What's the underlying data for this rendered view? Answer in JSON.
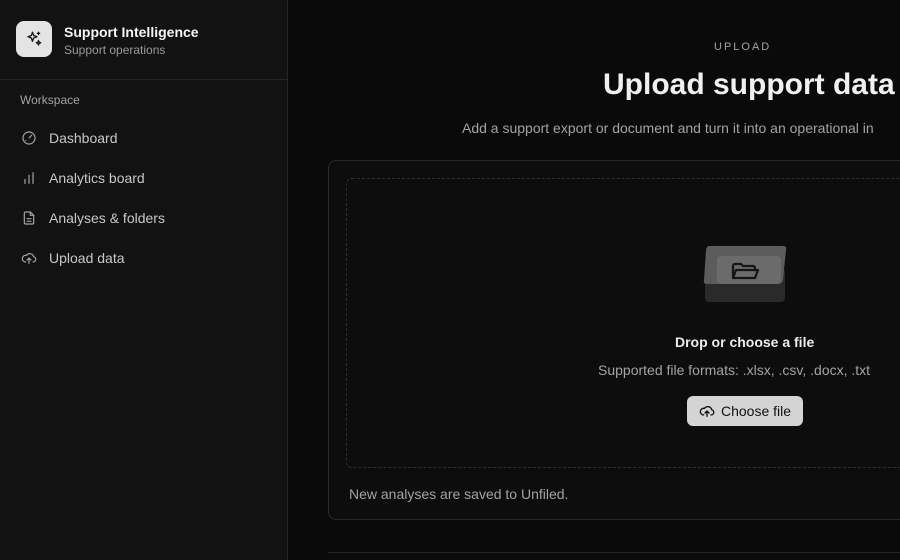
{
  "brand": {
    "title": "Support Intelligence",
    "subtitle": "Support operations",
    "icon": "sparkles-icon"
  },
  "sidebar": {
    "section_label": "Workspace",
    "items": [
      {
        "label": "Dashboard",
        "icon": "gauge-icon"
      },
      {
        "label": "Analytics board",
        "icon": "bar-chart-icon"
      },
      {
        "label": "Analyses & folders",
        "icon": "document-icon"
      },
      {
        "label": "Upload data",
        "icon": "cloud-upload-icon"
      }
    ]
  },
  "main": {
    "eyebrow": "UPLOAD",
    "title": "Upload support data",
    "description": "Add a support export or document and turn it into an operational in"
  },
  "dropzone": {
    "title": "Drop or choose a file",
    "formats": "Supported file formats: .xlsx, .csv, .docx, .txt",
    "button_label": "Choose file",
    "footer": "New analyses are saved to Unfiled."
  }
}
